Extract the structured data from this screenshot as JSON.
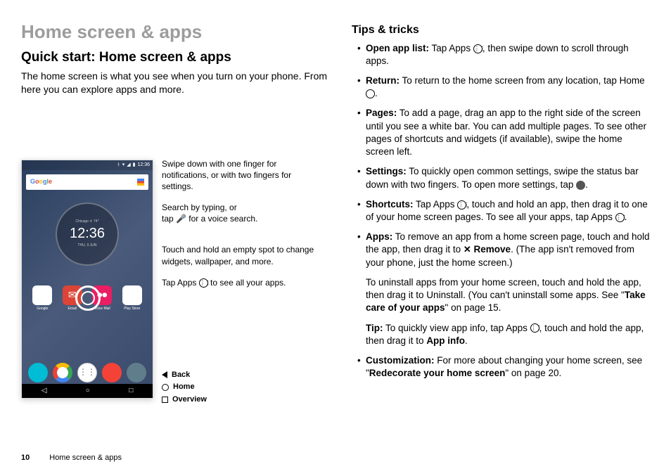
{
  "header": {
    "title": "Home screen & apps",
    "subtitle": "Quick start: Home screen & apps"
  },
  "intro": "The home screen is what you see when you turn on your phone. From here you can explore apps and more.",
  "phone": {
    "status_time": "12:36",
    "clock_time": "12:36",
    "apps": [
      "Google",
      "Email",
      "Voice Mail",
      "Play Store"
    ]
  },
  "callouts": {
    "c1": "Swipe down with one finger for notifications, or with two fingers for settings.",
    "c2a": "Search by typing, or",
    "c2b": "tap ",
    "c2c": " for a voice search.",
    "c3": "Touch and hold an empty spot to change widgets, wallpaper, and more.",
    "c4a": "Tap Apps ",
    "c4b": " to see all your apps.",
    "nav_back": "Back",
    "nav_home": "Home",
    "nav_overview": "Overview"
  },
  "tips": {
    "heading": "Tips & tricks",
    "items": [
      {
        "label": "Open app list:",
        "text1": " Tap Apps ",
        "text2": ", then swipe down to scroll through apps."
      },
      {
        "label": "Return:",
        "text1": " To return to the home screen from any location, tap Home ",
        "text2": "."
      },
      {
        "label": "Pages:",
        "text1": " To add a page, drag an app to the right side of the screen until you see a white bar. You can add multiple pages. To see other pages of shortcuts and widgets (if available), swipe the home screen left."
      },
      {
        "label": "Settings:",
        "text1": " To quickly open common settings, swipe the status bar down with two fingers. To open more settings, tap ",
        "text2": "."
      },
      {
        "label": "Shortcuts:",
        "text1": " Tap Apps ",
        "text2": ", touch and hold an app, then drag it to one of your home screen pages. To see all your apps, tap Apps ",
        "text3": "."
      },
      {
        "label": "Apps:",
        "text1": " To remove an app from a home screen page, touch and hold the app, then drag it to ",
        "remove": "Remove",
        "text2": ". (The app isn't removed from your phone, just the home screen.)"
      },
      {
        "label": "Customization:",
        "text1": " For more about changing your home screen, see \"",
        "link": "Redecorate your home screen",
        "text2": "\" on page 20."
      }
    ],
    "uninstall_p": "To uninstall apps from your home screen, touch and hold the app, then drag it to Uninstall. (You can't uninstall some apps. See \"",
    "uninstall_link": "Take care of your apps",
    "uninstall_p2": "\" on page 15.",
    "tip_label": "Tip:",
    "tip_text1": " To quickly view app info, tap Apps ",
    "tip_text2": ", touch and hold the app, then drag it to ",
    "tip_bold": "App info",
    "tip_text3": "."
  },
  "footer": {
    "page": "10",
    "section": "Home screen & apps"
  }
}
